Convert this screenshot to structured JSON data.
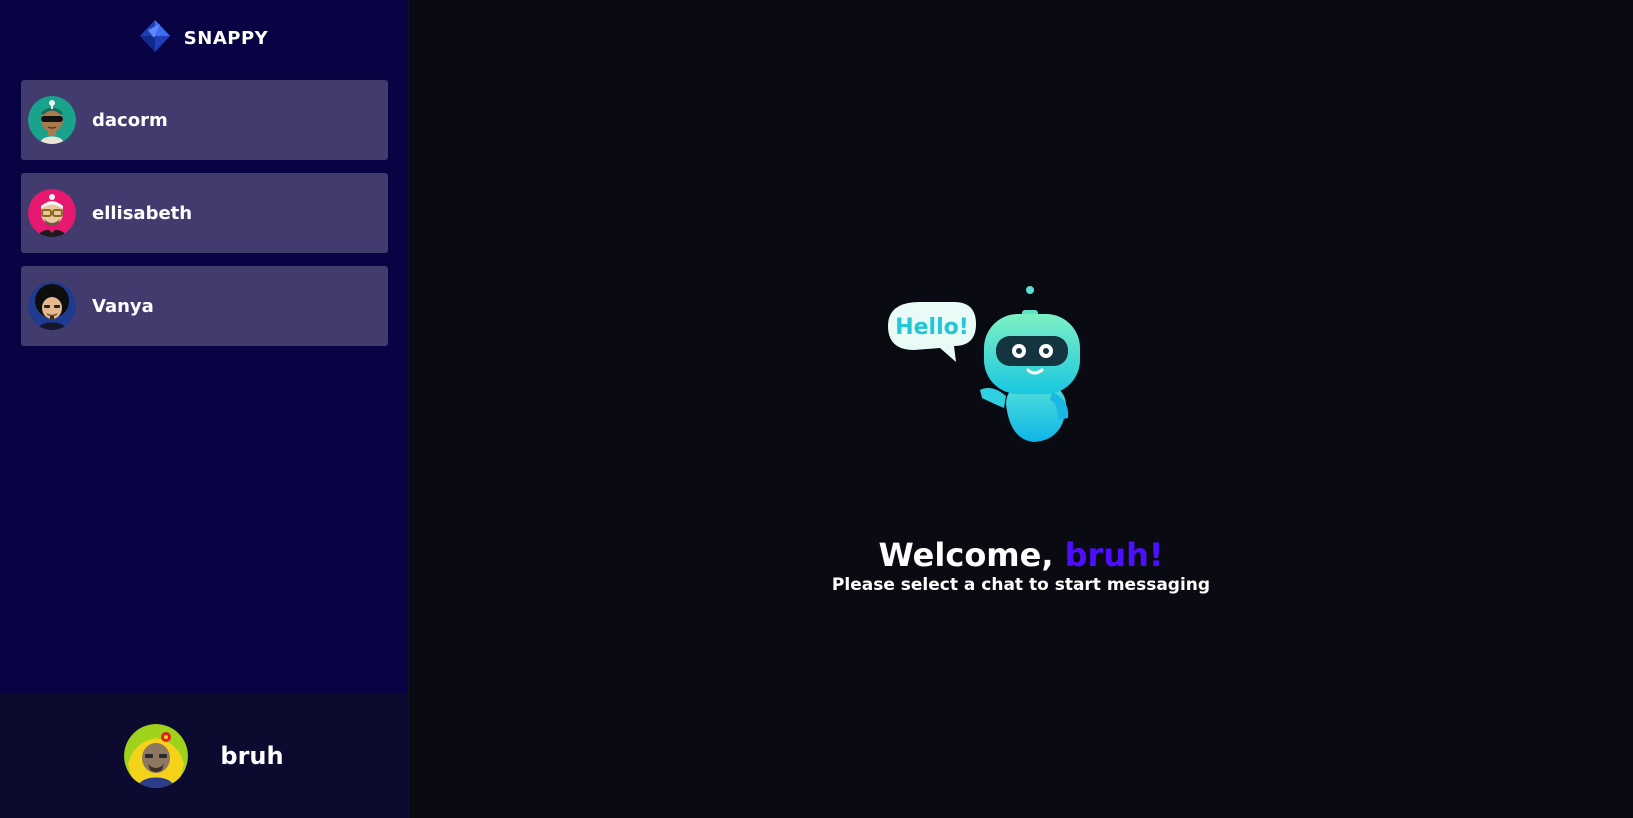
{
  "brand": {
    "name": "SNAPPY",
    "logo_icon": "snappy-logo-icon"
  },
  "contacts": [
    {
      "name": "dacorm",
      "avatar_icon": "avatar-teal-sunglasses",
      "bg": "#1aa38c"
    },
    {
      "name": "ellisabeth",
      "avatar_icon": "avatar-pink-glasses",
      "bg": "#e6186f"
    },
    {
      "name": "Vanya",
      "avatar_icon": "avatar-afro",
      "bg": "#1f3a8f"
    }
  ],
  "current_user": {
    "name": "bruh",
    "avatar_icon": "avatar-yellow-flower"
  },
  "welcome": {
    "greeting": "Welcome,",
    "username": "bruh!",
    "subtitle": "Please select a chat to start messaging",
    "robot_speech": "Hello!"
  },
  "colors": {
    "sidebar_bg": "#080343",
    "contact_bg": "#423c6e",
    "main_bg": "#0a0b12",
    "accent": "#4e0eff"
  }
}
